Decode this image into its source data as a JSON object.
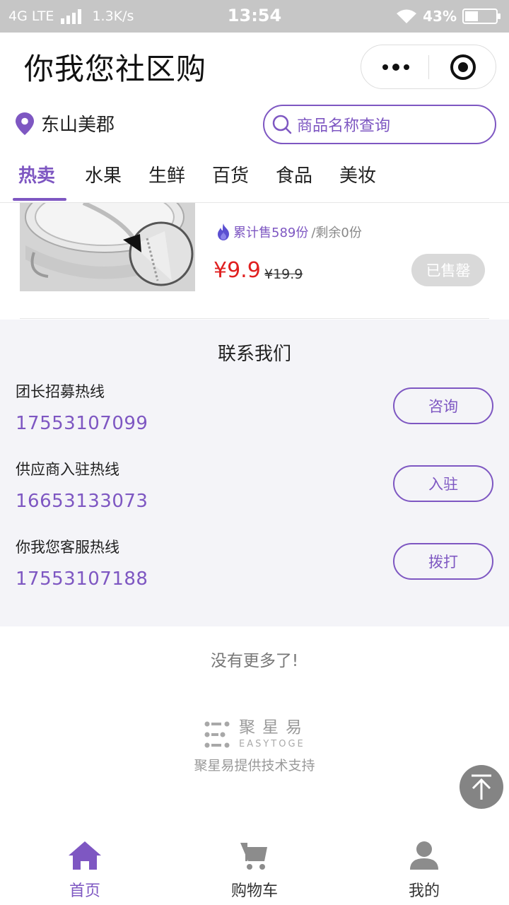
{
  "status_bar": {
    "network": "4G LTE",
    "speed": "1.3K/s",
    "time": "13:54",
    "battery_text": "43%",
    "battery_level": 0.43
  },
  "header": {
    "title": "你我您社区购"
  },
  "location": {
    "name": "东山美郡"
  },
  "search": {
    "placeholder": "商品名称查询"
  },
  "tabs": [
    "热卖",
    "水果",
    "生鲜",
    "百货",
    "食品",
    "美妆"
  ],
  "active_tab": 0,
  "product": {
    "sold_text": "累计售589份",
    "remain_text": "/剩余0份",
    "price": "¥9.9",
    "original_price": "¥19.9",
    "button_label": "已售罄"
  },
  "contact": {
    "title": "联系我们",
    "items": [
      {
        "label": "团长招募热线",
        "phone": "17553107099",
        "button": "咨询"
      },
      {
        "label": "供应商入驻热线",
        "phone": "16653133073",
        "button": "入驻"
      },
      {
        "label": "你我您客服热线",
        "phone": "17553107188",
        "button": "拨打"
      }
    ]
  },
  "footer": {
    "no_more": "没有更多了!",
    "brand_name": "聚星易",
    "brand_en": "EASYTOGE",
    "support": "聚星易提供技术支持"
  },
  "bottom_nav": [
    {
      "label": "首页",
      "icon": "home-icon"
    },
    {
      "label": "购物车",
      "icon": "cart-icon"
    },
    {
      "label": "我的",
      "icon": "user-icon"
    }
  ],
  "colors": {
    "accent": "#7e57c2",
    "price": "#e02020",
    "section_bg": "#f4f4f8"
  }
}
